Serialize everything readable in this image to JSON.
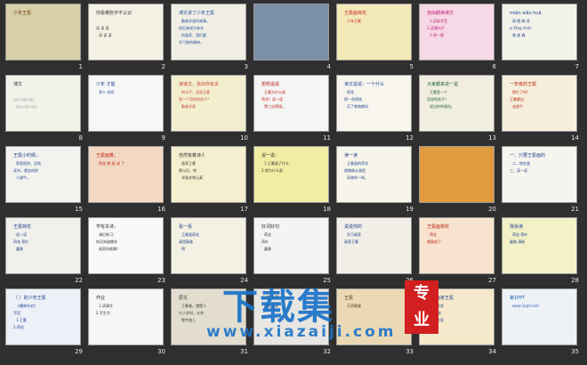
{
  "slides": [
    {
      "n": "1",
      "bg": "#d9cfa8",
      "lines": [
        "少年王冕"
      ],
      "tc": "#6a3b10"
    },
    {
      "n": "2",
      "bg": "#f4f1e4",
      "lines": [
        "你看哪些字不认识",
        "",
        "读 读 读",
        "读 读 读"
      ],
      "tc": "#333"
    },
    {
      "n": "3",
      "bg": "#f1efe5",
      "lines": [
        "课文讲了少年王冕",
        "勤奋学画的故事。",
        "他后来成为有名",
        "的画家，我们要",
        "学习他的精神。"
      ],
      "tc": "#1e4e9a"
    },
    {
      "n": "4",
      "bg": "#7b8fa6",
      "lines": [
        ""
      ],
      "tc": "#fff"
    },
    {
      "n": "5",
      "bg": "#f3e9b8",
      "lines": [
        "王冕画荷花",
        "少年王冕"
      ],
      "tc": "#c23"
    },
    {
      "n": "6",
      "bg": "#f6d8e6",
      "lines": [
        "自由朗读课文",
        "1.读准字音",
        "2.读通句子",
        "3.想一想"
      ],
      "tc": "#c0207a"
    },
    {
      "n": "7",
      "bg": "#f3f2ea",
      "lines": [
        "mián xiǎo huā",
        "丽 眠 晓 花",
        "yì fāng chūn",
        "香 放 春"
      ],
      "tc": "#1c3f8c"
    },
    {
      "n": "8",
      "bg": "#f3f2ea",
      "lines": [
        "课文",
        "",
        "○○ ○○ ○○",
        "○○ ○○ ○○"
      ],
      "tc": "#333"
    },
    {
      "n": "9",
      "bg": "#f7f7f7",
      "lines": [
        "少年   才能",
        "多少   长短"
      ],
      "tc": "#1c3f8c"
    },
    {
      "n": "10",
      "bg": "#f2efcf",
      "lines": [
        "读读文，找出你有关",
        "的句子，说说王冕",
        "是一个怎样的孩子？",
        "勤奋学画"
      ],
      "tc": "#c43"
    },
    {
      "n": "11",
      "bg": "#f5f5f5",
      "lines": [
        "想想说说",
        "王冕为什么画",
        "荷花？读一读",
        "第三自然段。"
      ],
      "tc": "#b21"
    },
    {
      "n": "12",
      "bg": "#f7f5ee",
      "lines": [
        "读文说说：一个什么",
        "荷花",
        "得一些铜钱",
        "买了笔和颜料"
      ],
      "tc": "#1c3f8c"
    },
    {
      "n": "13",
      "bg": "#f1ede0",
      "lines": [
        "大家都来说一说",
        "王冕是一个",
        "怎样的孩子？",
        "说出你的理由。"
      ],
      "tc": "#1c5f3c"
    },
    {
      "n": "14",
      "bg": "#f5efdc",
      "lines": [
        "一年级的王冕",
        "帮忙了吗？",
        "王冕都出",
        "去放牛"
      ],
      "tc": "#b21"
    },
    {
      "n": "15",
      "bg": "#f2f2ef",
      "lines": [
        "王冕小时候，",
        "家里很穷，没钱",
        "读书，就去给别",
        "人放牛。"
      ],
      "tc": "#1c3f8c"
    },
    {
      "n": "16",
      "bg": "#f3d9c4",
      "lines": [
        "王冕画着，",
        "荷花 就 画 成 了"
      ],
      "tc": "#b21"
    },
    {
      "n": "17",
      "bg": "#f5efcf",
      "lines": [
        "自然有着诗人",
        "画家王冕",
        "那以后，他",
        "学画非常认真"
      ],
      "tc": "#333"
    },
    {
      "n": "18",
      "bg": "#f1eea3",
      "lines": [
        "说一说：",
        "1.王冕画了什么",
        "2.他为什么画"
      ],
      "tc": "#333"
    },
    {
      "n": "19",
      "bg": "#f7f5ea",
      "lines": [
        "读一读",
        "王冕画的荷花",
        "就像刚从湖里",
        "采来的一样。"
      ],
      "tc": "#1c3f8c"
    },
    {
      "n": "20",
      "bg": "#e29a3e",
      "lines": [
        ""
      ],
      "tc": "#fff"
    },
    {
      "n": "21",
      "bg": "#f5f4ee",
      "lines": [
        "一、只要王冕画的",
        "二、他在画",
        "三、读一读"
      ],
      "tc": "#1c3f8c"
    },
    {
      "n": "22",
      "bg": "#f1f0ec",
      "lines": [
        "王冕荷花",
        "读一读",
        "荷花 荷叶",
        "露珠"
      ],
      "tc": "#1c3f8c"
    },
    {
      "n": "23",
      "bg": "#f9f9f9",
      "lines": [
        "学有关诗，",
        "课后练习：",
        "你还知道哪些",
        "画家的故事？"
      ],
      "tc": "#333"
    },
    {
      "n": "24",
      "bg": "#f3f1e3",
      "lines": [
        "看一看",
        "王冕画荷花",
        "画得真像",
        "啊"
      ],
      "tc": "#1c3f8c"
    },
    {
      "n": "25",
      "bg": "#f4f4f2",
      "lines": [
        "好词好句",
        "荷花",
        "荷叶",
        "露珠"
      ],
      "tc": "#333"
    },
    {
      "n": "26",
      "bg": "#f1efe8",
      "lines": [
        "说说你的",
        "学习收获",
        "画家王冕"
      ],
      "tc": "#1c3f8c"
    },
    {
      "n": "27",
      "bg": "#f7e3cf",
      "lines": [
        "王冕画荷花",
        "荷花",
        "就画成了"
      ],
      "tc": "#b21"
    },
    {
      "n": "28",
      "bg": "#f3f1c6",
      "lines": [
        "我会读",
        "荷花 荷叶",
        "露珠 清新"
      ],
      "tc": "#1c3f8c"
    },
    {
      "n": "29",
      "bg": "#eef0f7",
      "lines": [
        "（  ）的少年王冕",
        "《儒林外史》",
        "写话",
        "1.王冕",
        "2.荷花"
      ],
      "tc": "#1c3f8c"
    },
    {
      "n": "30",
      "bg": "#f6f6f6",
      "lines": [
        "作业",
        "1.读课文",
        "2.写生字"
      ],
      "tc": "#333"
    },
    {
      "n": "31",
      "bg": "#e2ddcf",
      "lines": [
        "原文",
        "王冕者，诸暨人",
        "七八岁时，父命",
        "牧牛陇上"
      ],
      "tc": "#333"
    },
    {
      "n": "32",
      "bg": "#e8e6e2",
      "lines": [
        "少年王冕",
        "原文阅读"
      ],
      "tc": "#333"
    },
    {
      "n": "33",
      "bg": "#ead9b4",
      "lines": [
        "王冕",
        "天资聪颖"
      ],
      "tc": "#5a3510"
    },
    {
      "n": "34",
      "bg": "#f6e9cb",
      "lines": [
        "元代画家王冕",
        "自幼家贫",
        "勤奋学画",
        "成为名家"
      ],
      "tc": "#1c3f8c"
    },
    {
      "n": "35",
      "bg": "#eef1f6",
      "lines": [
        "第1PPT",
        "www.1ppt.com"
      ],
      "tc": "#1c5fb0"
    }
  ],
  "watermark": {
    "brand": "下载集",
    "badge_top": "专",
    "badge_bottom": "业",
    "url": "www.xiazaiji.com",
    "color": "#1a73c9",
    "badge_color": "#d21f1f"
  }
}
